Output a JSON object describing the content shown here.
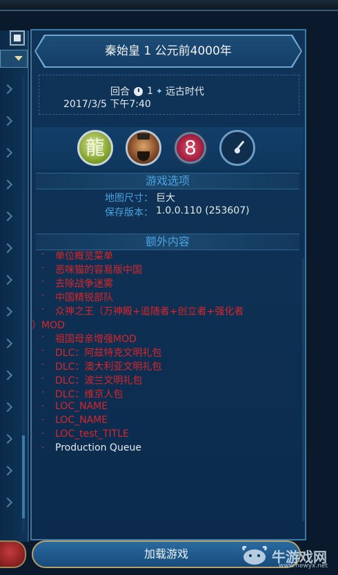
{
  "game_info": {
    "title": "秦始皇 1 公元前4000年",
    "turn_label": "回合",
    "turn_value": "1",
    "era": "远古时代",
    "save_date": "2017/3/5 下午7:40"
  },
  "icons": {
    "civ": "dragon-emblem",
    "leader": "qin-shi-huang-portrait",
    "difficulty_number": "8",
    "speed": "speed-dial"
  },
  "game_options": {
    "header": "游戏选项",
    "map_size_label": "地图尺寸：",
    "map_size_value": "巨大",
    "save_version_label": "保存版本：",
    "save_version_value": "1.0.0.110 (253607)"
  },
  "extra_content": {
    "header": "额外内容",
    "items": [
      {
        "text": "单位概览菜单",
        "status": "missing"
      },
      {
        "text": "恶咪猫的容易版中国",
        "status": "missing"
      },
      {
        "text": "去除战争迷雾",
        "status": "missing"
      },
      {
        "text": "中国精锐部队",
        "status": "missing"
      },
      {
        "text": "众神之王（万神殿+追随者+创立者+强化者",
        "status": "missing"
      },
      {
        "text": "）MOD",
        "status": "missing"
      },
      {
        "text": "祖国母亲增强MOD",
        "status": "missing"
      },
      {
        "text": "DLC：阿兹特克文明礼包",
        "status": "missing"
      },
      {
        "text": "DLC：澳大利亚文明礼包",
        "status": "missing"
      },
      {
        "text": "DLC：波兰文明礼包",
        "status": "missing"
      },
      {
        "text": "DLC：维京人包",
        "status": "missing"
      },
      {
        "text": "LOC_NAME",
        "status": "missing"
      },
      {
        "text": "LOC_NAME",
        "status": "missing"
      },
      {
        "text": "LOC_test_TITLE",
        "status": "missing"
      },
      {
        "text": "Production Queue",
        "status": "ok"
      }
    ]
  },
  "load_button": "加载游戏",
  "watermark": {
    "text": "牛游戏网",
    "url": "www.newyx.net"
  },
  "colors": {
    "missing": "#d9262a",
    "ok": "#e6ecf0",
    "label_blue": "#4aa3e0",
    "panel": "#0f3458"
  }
}
